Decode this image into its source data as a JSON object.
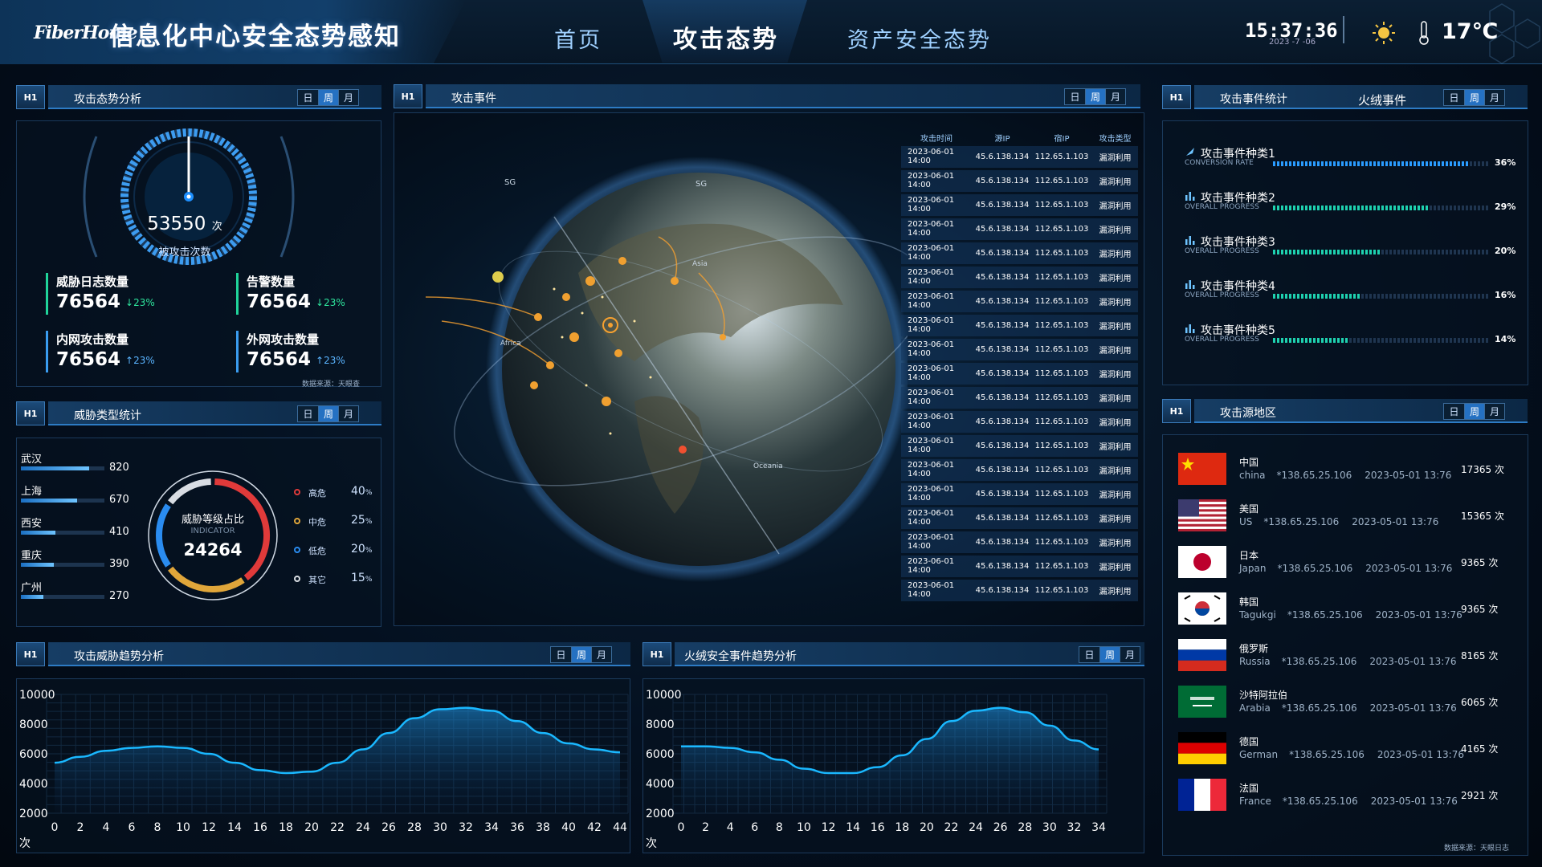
{
  "header": {
    "logo": "FiberHome",
    "title": "信息化中心安全态势感知",
    "nav": [
      "首页",
      "攻击态势",
      "资产安全态势"
    ],
    "active_nav": "攻击态势",
    "time": "15:37:36",
    "date": "2023 -7 -06",
    "temperature": "17℃",
    "weather_icon": "sun-icon",
    "accent": "#2d7bc4"
  },
  "tabs": [
    "日",
    "周",
    "月"
  ],
  "panel_icon": "H1",
  "attack_overview": {
    "title": "攻击态势分析",
    "gauge_value": "53550",
    "gauge_unit": "次",
    "gauge_label": "被攻击次数",
    "stats": [
      {
        "label": "威胁日志数量",
        "value": "76564",
        "change": "23%",
        "direction": "down"
      },
      {
        "label": "告警数量",
        "value": "76564",
        "change": "23%",
        "direction": "down"
      },
      {
        "label": "内网攻击数量",
        "value": "76564",
        "change": "23%",
        "direction": "up"
      },
      {
        "label": "外网攻击数量",
        "value": "76564",
        "change": "23%",
        "direction": "up"
      }
    ],
    "source": "数据来源：天眼查"
  },
  "threat_types": {
    "title": "威胁类型统计",
    "cities": [
      {
        "name": "武汉",
        "value": 820
      },
      {
        "name": "上海",
        "value": 670
      },
      {
        "name": "西安",
        "value": 410
      },
      {
        "name": "重庆",
        "value": 390
      },
      {
        "name": "广州",
        "value": 270
      }
    ],
    "donut_title": "威胁等级占比",
    "donut_sub": "INDICATOR",
    "donut_value": "24264",
    "levels": [
      {
        "name": "高危",
        "pct": 40,
        "color": "#e03a3a"
      },
      {
        "name": "中危",
        "pct": 25,
        "color": "#e0a63a"
      },
      {
        "name": "低危",
        "pct": 20,
        "color": "#2a8cf0"
      },
      {
        "name": "其它",
        "pct": 15,
        "color": "#d9dde3"
      }
    ],
    "pct_suffix": "%"
  },
  "attack_events": {
    "title": "攻击事件",
    "columns": [
      "攻击时间",
      "源IP",
      "宿IP",
      "攻击类型"
    ],
    "rows": [
      [
        "2023-06-01 14:00",
        "45.6.138.134",
        "112.65.1.103",
        "漏洞利用"
      ],
      [
        "2023-06-01 14:00",
        "45.6.138.134",
        "112.65.1.103",
        "漏洞利用"
      ],
      [
        "2023-06-01 14:00",
        "45.6.138.134",
        "112.65.1.103",
        "漏洞利用"
      ],
      [
        "2023-06-01 14:00",
        "45.6.138.134",
        "112.65.1.103",
        "漏洞利用"
      ],
      [
        "2023-06-01 14:00",
        "45.6.138.134",
        "112.65.1.103",
        "漏洞利用"
      ],
      [
        "2023-06-01 14:00",
        "45.6.138.134",
        "112.65.1.103",
        "漏洞利用"
      ],
      [
        "2023-06-01 14:00",
        "45.6.138.134",
        "112.65.1.103",
        "漏洞利用"
      ],
      [
        "2023-06-01 14:00",
        "45.6.138.134",
        "112.65.1.103",
        "漏洞利用"
      ],
      [
        "2023-06-01 14:00",
        "45.6.138.134",
        "112.65.1.103",
        "漏洞利用"
      ],
      [
        "2023-06-01 14:00",
        "45.6.138.134",
        "112.65.1.103",
        "漏洞利用"
      ],
      [
        "2023-06-01 14:00",
        "45.6.138.134",
        "112.65.1.103",
        "漏洞利用"
      ],
      [
        "2023-06-01 14:00",
        "45.6.138.134",
        "112.65.1.103",
        "漏洞利用"
      ],
      [
        "2023-06-01 14:00",
        "45.6.138.134",
        "112.65.1.103",
        "漏洞利用"
      ],
      [
        "2023-06-01 14:00",
        "45.6.138.134",
        "112.65.1.103",
        "漏洞利用"
      ],
      [
        "2023-06-01 14:00",
        "45.6.138.134",
        "112.65.1.103",
        "漏洞利用"
      ],
      [
        "2023-06-01 14:00",
        "45.6.138.134",
        "112.65.1.103",
        "漏洞利用"
      ],
      [
        "2023-06-01 14:00",
        "45.6.138.134",
        "112.65.1.103",
        "漏洞利用"
      ],
      [
        "2023-06-01 14:00",
        "45.6.138.134",
        "112.65.1.103",
        "漏洞利用"
      ],
      [
        "2023-06-01 14:00",
        "45.6.138.134",
        "112.65.1.103",
        "漏洞利用"
      ]
    ],
    "globe_labels": [
      "SG",
      "SG",
      "Africa",
      "Oceania",
      "Asia"
    ]
  },
  "event_stats": {
    "title": "攻击事件统计",
    "subtab": "火绒事件",
    "items": [
      {
        "name": "攻击事件种类1",
        "sub": "CONVERSION RATE",
        "pct": 36,
        "color": "#2a9cff"
      },
      {
        "name": "攻击事件种类2",
        "sub": "OVERALL PROGRESS",
        "pct": 29,
        "color": "#1ed2b0"
      },
      {
        "name": "攻击事件种类3",
        "sub": "OVERALL PROGRESS",
        "pct": 20,
        "color": "#1ed2b0"
      },
      {
        "name": "攻击事件种类4",
        "sub": "OVERALL PROGRESS",
        "pct": 16,
        "color": "#1ed2b0"
      },
      {
        "name": "攻击事件种类5",
        "sub": "OVERALL PROGRESS",
        "pct": 14,
        "color": "#1ed2b0"
      }
    ],
    "pct_suffix": "%"
  },
  "source_regions": {
    "title": "攻击源地区",
    "source": "数据来源：天眼日志",
    "items": [
      {
        "cn": "中国",
        "en": "china",
        "ip": "*138.65.25.106",
        "time": "2023-05-01  13:76",
        "count": "17365 次",
        "flag": "china-flag"
      },
      {
        "cn": "美国",
        "en": "US",
        "ip": "*138.65.25.106",
        "time": "2023-05-01  13:76",
        "count": "15365 次",
        "flag": "us-flag"
      },
      {
        "cn": "日本",
        "en": "Japan",
        "ip": "*138.65.25.106",
        "time": "2023-05-01  13:76",
        "count": "9365 次",
        "flag": "japan-flag"
      },
      {
        "cn": "韩国",
        "en": "Tagukgi",
        "ip": "*138.65.25.106",
        "time": "2023-05-01  13:76",
        "count": "9365 次",
        "flag": "korea-flag"
      },
      {
        "cn": "俄罗斯",
        "en": "Russia",
        "ip": "*138.65.25.106",
        "time": "2023-05-01  13:76",
        "count": "8165 次",
        "flag": "russia-flag"
      },
      {
        "cn": "沙特阿拉伯",
        "en": "Arabia",
        "ip": "*138.65.25.106",
        "time": "2023-05-01  13:76",
        "count": "6065 次",
        "flag": "saudi-flag"
      },
      {
        "cn": "德国",
        "en": "German",
        "ip": "*138.65.25.106",
        "time": "2023-05-01  13:76",
        "count": "4165 次",
        "flag": "germany-flag"
      },
      {
        "cn": "法国",
        "en": "France",
        "ip": "*138.65.25.106",
        "time": "2023-05-01  13:76",
        "count": "2921 次",
        "flag": "france-flag"
      }
    ]
  },
  "trend_left": {
    "title": "攻击威胁趋势分析"
  },
  "trend_right": {
    "title": "火绒安全事件趋势分析"
  },
  "chart_data": [
    {
      "type": "area",
      "title": "攻击威胁趋势分析",
      "ylabel": "次",
      "ylim": [
        2000,
        10000
      ],
      "yticks": [
        10000,
        8000,
        6000,
        4000,
        2000
      ],
      "x": [
        0,
        2,
        4,
        6,
        8,
        10,
        12,
        14,
        16,
        18,
        20,
        22,
        24,
        26,
        28,
        30,
        32,
        34,
        36,
        38,
        40,
        42,
        44
      ],
      "series": [
        {
          "values": [
            5400,
            5800,
            6200,
            6400,
            6500,
            6400,
            6000,
            5400,
            4900,
            4700,
            4800,
            5400,
            6300,
            7400,
            8400,
            9000,
            9100,
            8900,
            8200,
            7400,
            6700,
            6300,
            6100
          ]
        }
      ],
      "grid": true
    },
    {
      "type": "area",
      "title": "火绒安全事件趋势分析",
      "ylabel": "次",
      "ylim": [
        2000,
        10000
      ],
      "yticks": [
        10000,
        8000,
        6000,
        4000,
        2000
      ],
      "x": [
        0,
        2,
        4,
        6,
        8,
        10,
        12,
        14,
        16,
        18,
        20,
        22,
        24,
        26,
        28,
        30,
        32,
        34
      ],
      "series": [
        {
          "values": [
            6500,
            6500,
            6400,
            6100,
            5600,
            5000,
            4700,
            4700,
            5100,
            5900,
            7000,
            8200,
            8900,
            9100,
            8800,
            7900,
            6900,
            6300
          ]
        }
      ],
      "grid": true
    }
  ]
}
